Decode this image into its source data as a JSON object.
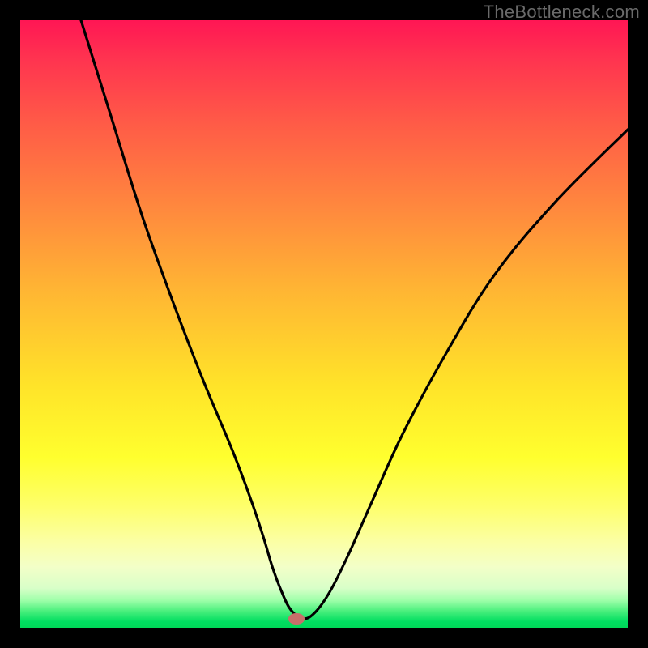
{
  "watermark": "TheBottleneck.com",
  "colors": {
    "black": "#000000",
    "curve": "#000000",
    "marker": "#c76f6a",
    "watermark_text": "#6a6a6a",
    "gradient_top": "#ff1654",
    "gradient_bottom": "#00d858"
  },
  "chart_data": {
    "type": "line",
    "title": "",
    "xlabel": "",
    "ylabel": "",
    "xlim": [
      0,
      100
    ],
    "ylim": [
      0,
      100
    ],
    "grid": false,
    "series": [
      {
        "name": "bottleneck-curve",
        "x": [
          10,
          15,
          20,
          25,
          30,
          35,
          38,
          40,
          41.5,
          43,
          44.5,
          46.5,
          48.5,
          51,
          54,
          58,
          63,
          70,
          78,
          88,
          100
        ],
        "y": [
          100,
          84,
          68,
          54,
          41,
          29,
          21,
          15,
          10,
          6,
          3,
          1.5,
          2.5,
          6,
          12,
          21,
          32,
          45,
          58,
          70,
          82
        ]
      }
    ],
    "annotations": [
      {
        "name": "minimum-marker",
        "x": 45.5,
        "y": 1.5
      }
    ],
    "legend": false
  }
}
